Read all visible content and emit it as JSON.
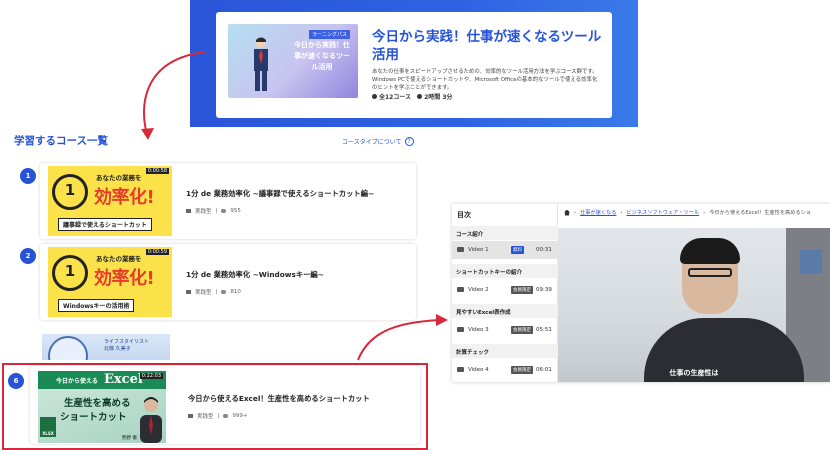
{
  "hero": {
    "thumb_tag": "ラーニングパス",
    "thumb_title": "今日から実践！仕事が速くなるツール活用",
    "title": "今日から実践！仕事が速くなるツール活用",
    "description": "あなたの仕事をスピードアップさせるための、効率的なツール活用方法を学ぶコース群です。Windows PCで使えるショートカットや、Microsoft Officeの基本的なツールで使える効率化のヒントを学ぶことができます。",
    "courses": "全12コース",
    "duration": "2時間 3分"
  },
  "section": {
    "title": "学習するコース一覧",
    "link": "コースタイプについて",
    "help_icon": "?"
  },
  "courses": [
    {
      "number": "1",
      "thumb_duration": "0:00:58",
      "thumb_one": "1",
      "thumb_sub": "あなたの業務を",
      "thumb_big": "効率化!",
      "thumb_band": "議事録で使えるショートカット",
      "title": "1分 de 業務効率化 ~議事録で使えるショートカット編~",
      "type": "実践型",
      "views": "955"
    },
    {
      "number": "2",
      "thumb_duration": "0:00:59",
      "thumb_one": "1",
      "thumb_sub": "あなたの業務を",
      "thumb_big": "効率化!",
      "thumb_band": "Windowsキーの活用術",
      "title": "1分 de 業務効率化 ~Windowsキー編~",
      "type": "実践型",
      "views": "810"
    },
    {
      "number": "6",
      "thumb_duration": "0:22:03",
      "thumb_top": "今日から使える",
      "thumb_excel": "Excel",
      "thumb_line1": "生産性を高める",
      "thumb_line2": "ショートカット",
      "thumb_xlsx": "XLSX",
      "thumb_name": "熊野 徹",
      "title": "今日から使えるExcel！生産性を高めるショートカット",
      "type": "実践型",
      "views": "999+"
    }
  ],
  "partial_card": {
    "caption_line1": "ライフスタイリスト",
    "caption_line2": "北條 久美子"
  },
  "player": {
    "toc_title": "目次",
    "breadcrumb": [
      "仕事が速くなる",
      "ビジネスソフトウェア・ツール",
      "今日から使えるExcel！生産性を高めるショ"
    ],
    "sections": [
      {
        "title": "コース紹介",
        "video": "Video 1",
        "badge": "無料",
        "time": "00:31"
      },
      {
        "title": "ショートカットキーの紹介",
        "video": "Video 2",
        "badge": "会員限定",
        "time": "09:39"
      },
      {
        "title": "見やすいExcel表作成",
        "video": "Video 3",
        "badge": "会員限定",
        "time": "05:51"
      },
      {
        "title": "計算チェック",
        "video": "Video 4",
        "badge": "会員限定",
        "time": "06:01"
      }
    ],
    "subtitle": "仕事の生産性は"
  },
  "colors": {
    "brand_blue": "#2653d8",
    "highlight_red": "#d8283a",
    "free_badge": "#2653d8",
    "member_badge": "#555555"
  }
}
